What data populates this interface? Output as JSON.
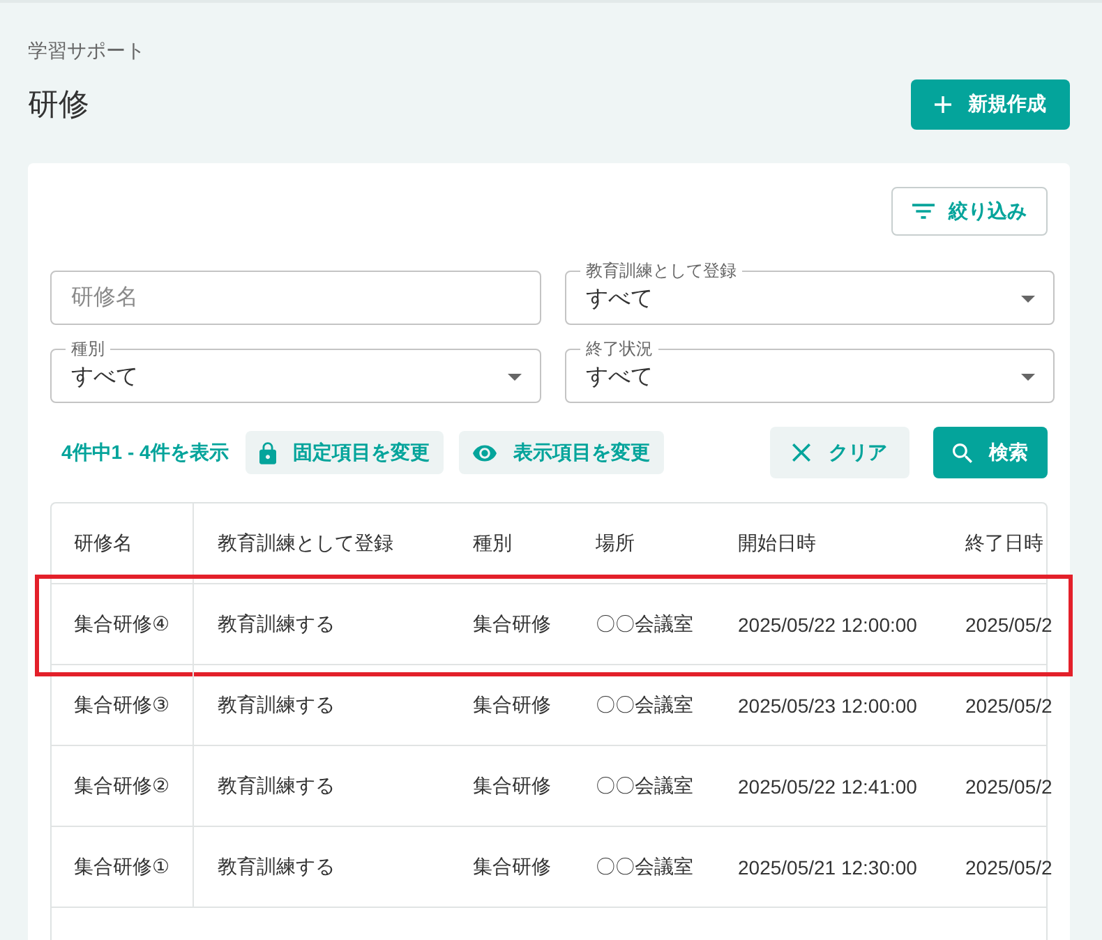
{
  "breadcrumb": "学習サポート",
  "page_title": "研修",
  "create_button": {
    "label": "新規作成"
  },
  "filter_button": {
    "label": "絞り込み"
  },
  "filter_rows": [
    {
      "fields": [
        {
          "kind": "text",
          "placeholder": "研修名"
        },
        {
          "kind": "select",
          "label": "教育訓練として登録",
          "value": "すべて"
        }
      ]
    },
    {
      "fields": [
        {
          "kind": "select",
          "label": "種別",
          "value": "すべて"
        },
        {
          "kind": "select",
          "label": "終了状況",
          "value": "すべて"
        }
      ]
    }
  ],
  "result_count": "4件中1 - 4件を表示",
  "toolbar_buttons": [
    {
      "kind": "lock",
      "label": "固定項目を変更"
    },
    {
      "kind": "eye",
      "label": "表示項目を変更"
    }
  ],
  "clear_button": {
    "label": "クリア"
  },
  "search_button": {
    "label": "検索"
  },
  "table": {
    "columns": [
      "研修名",
      "教育訓練として登録",
      "種別",
      "場所",
      "開始日時",
      "終了日時"
    ],
    "rows": [
      {
        "annotated": true,
        "cells": [
          "集合研修④",
          "教育訓練する",
          "集合研修",
          "〇〇会議室",
          "2025/05/22 12:00:00",
          "2025/05/2"
        ]
      },
      {
        "annotated": false,
        "cells": [
          "集合研修③",
          "教育訓練する",
          "集合研修",
          "〇〇会議室",
          "2025/05/23 12:00:00",
          "2025/05/2"
        ]
      },
      {
        "annotated": false,
        "cells": [
          "集合研修②",
          "教育訓練する",
          "集合研修",
          "〇〇会議室",
          "2025/05/22 12:41:00",
          "2025/05/2"
        ]
      },
      {
        "annotated": false,
        "cells": [
          "集合研修①",
          "教育訓練する",
          "集合研修",
          "〇〇会議室",
          "2025/05/21 12:30:00",
          "2025/05/2"
        ]
      }
    ]
  }
}
